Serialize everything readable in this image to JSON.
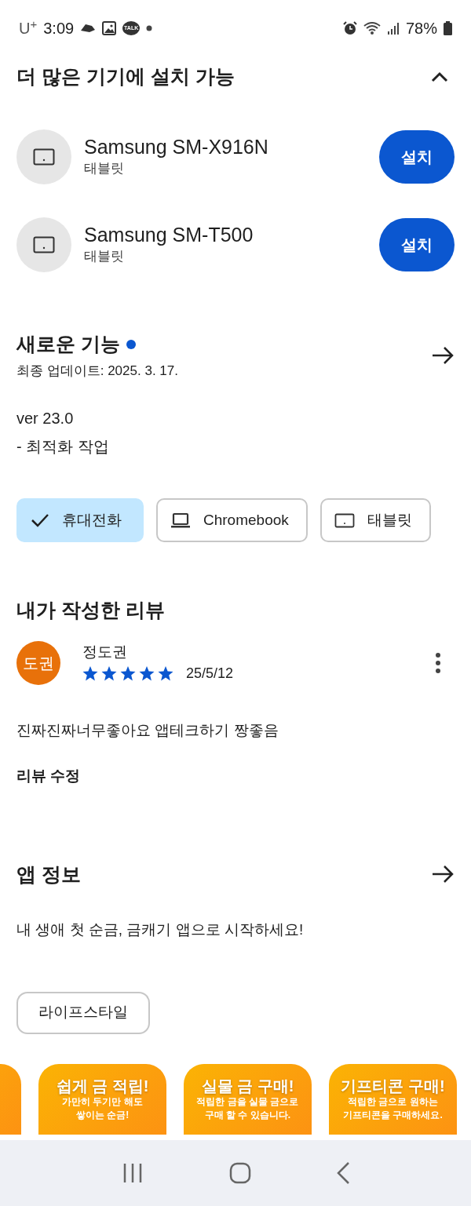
{
  "status_bar": {
    "carrier": "U$^{+}$",
    "time": "3:09",
    "talk_badge": "TALK",
    "battery": "78%"
  },
  "devices_section": {
    "title": "더 많은 기기에 설치 가능",
    "expanded": true,
    "devices": [
      {
        "name": "Samsung SM-X916N",
        "type": "태블릿",
        "button": "설치"
      },
      {
        "name": "Samsung SM-T500",
        "type": "태블릿",
        "button": "설치"
      }
    ]
  },
  "whats_new": {
    "title": "새로운 기능",
    "updated": "최종 업데이트: 2025. 3. 17.",
    "lines": [
      "ver 23.0",
      "- 최적화 작업"
    ]
  },
  "device_chips": [
    {
      "label": "휴대전화",
      "selected": true
    },
    {
      "kind": "laptop",
      "label": "Chromebook",
      "selected": false
    },
    {
      "kind": "tablet",
      "label": "태블릿",
      "selected": false
    }
  ],
  "my_review": {
    "title": "내가 작성한 리뷰",
    "avatar": "도권",
    "author": "정도권",
    "stars": 5,
    "date": "25/5/12",
    "text": "진짜진짜너무좋아요 앱테크하기 짱좋음",
    "edit": "리뷰 수정"
  },
  "app_info": {
    "title": "앱 정보",
    "description": "내 생애 첫 순금, 금캐기 앱으로 시작하세요!",
    "tag": "라이프스타일"
  },
  "screenshots": [
    {
      "kind": "partial"
    },
    {
      "kind": "promo",
      "title": "쉽게 금 적립!",
      "lines": [
        "가만히 두기만 해도",
        "쌓이는 순금!"
      ]
    },
    {
      "kind": "promo",
      "title": "실물 금 구매!",
      "lines": [
        "적립한 금을 실물 금으로",
        "구매 할 수 있습니다."
      ]
    },
    {
      "kind": "promo",
      "title": "기프티콘 구매!",
      "lines": [
        "적립한 금으로 원하는",
        "기프티콘을 구매하세요."
      ]
    }
  ]
}
